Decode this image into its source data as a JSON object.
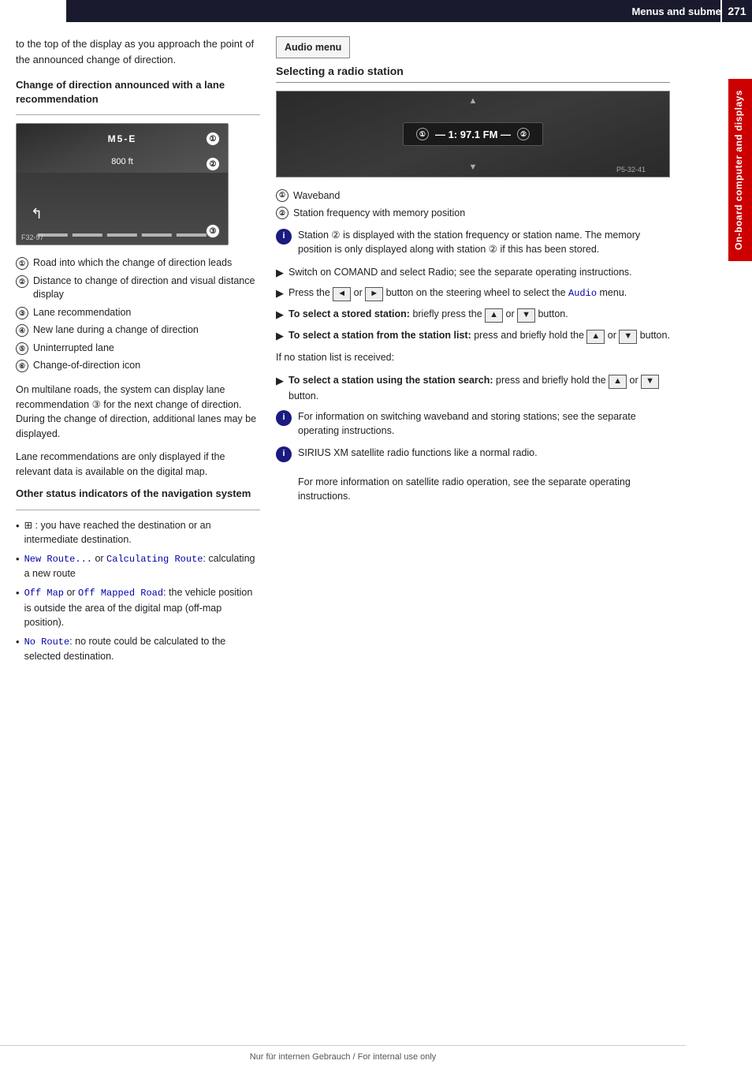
{
  "header": {
    "title": "Menus and submenus",
    "page_number": "271"
  },
  "side_tab": {
    "label": "On-board computer and displays"
  },
  "left_col": {
    "intro": "to the top of the display as you approach the point of the announced change of direction.",
    "section1": {
      "heading": "Change of direction announced with a lane recommendation",
      "nav_image": {
        "label_m5e": "M5-E",
        "badge_1": "①",
        "badge_2": "②",
        "badge_3": "③",
        "dist_label": "800 ft",
        "bottom_label": "F32-97"
      },
      "numbered_items": [
        {
          "num": "①",
          "text": "Road into which the change of direction leads"
        },
        {
          "num": "②",
          "text": "Distance to change of direction and visual distance display"
        },
        {
          "num": "③",
          "text": "Lane recommendation"
        },
        {
          "num": "④",
          "text": "New lane during a change of direction"
        },
        {
          "num": "⑤",
          "text": "Uninterrupted lane"
        },
        {
          "num": "⑥",
          "text": "Change-of-direction icon"
        }
      ],
      "body_text": [
        "On multilane roads, the system can display lane recommendation ③ for the next change of direction. During the change of direction, additional lanes may be displayed.",
        "Lane recommendations are only displayed if the relevant data is available on the digital map."
      ]
    },
    "section2": {
      "heading": "Other status indicators of the navigation system",
      "bullets": [
        {
          "icon": "⊞",
          "text": " : you have reached the destination or an intermediate destination."
        },
        {
          "text_prefix": "New Route...",
          "text_mid": " or ",
          "text_code": "Calculating Route",
          "text_suffix": ": calculating a new route"
        },
        {
          "text_prefix": "Off Map",
          "text_mid": " or ",
          "text_code": "Off Mapped Road",
          "text_suffix": ": the vehicle position is outside the area of the digital map (off-map position)."
        },
        {
          "text_prefix": "No Route",
          "text_suffix": ": no route could be calculated to the selected destination."
        }
      ]
    }
  },
  "right_col": {
    "audio_menu_label": "Audio menu",
    "section_heading": "Selecting a radio station",
    "radio_image": {
      "display_text": "1: 97.1 FM",
      "badge_1": "①",
      "badge_2": "②",
      "bottom_label": "P5-32-41"
    },
    "waveband_items": [
      {
        "num": "①",
        "text": "Waveband"
      },
      {
        "num": "②",
        "text": "Station frequency with memory position"
      }
    ],
    "info_boxes": [
      {
        "icon": "i",
        "text": "Station ② is displayed with the station frequency or station name. The memory position is only displayed along with station ② if this has been stored."
      }
    ],
    "steps": [
      {
        "type": "arrow",
        "text": "Switch on COMAND and select Radio; see the separate operating instructions."
      },
      {
        "type": "arrow",
        "text_before": "Press the ",
        "btn_left": "◄",
        "text_mid": " or ",
        "btn_right": "►",
        "text_after": " button on the steering wheel to select the Audio menu.",
        "has_code": true,
        "code_word": "Audio"
      },
      {
        "type": "arrow_bold",
        "bold": "To select a stored station:",
        "text": " briefly press the ",
        "btn1": "▲",
        "text2": " or ",
        "btn2": "▼",
        "text3": " button."
      },
      {
        "type": "arrow_bold",
        "bold": "To select a station from the station list:",
        "text": " press and briefly hold the ",
        "btn1": "▲",
        "text2": " or ",
        "btn2": "▼",
        "text3": " button."
      }
    ],
    "if_no_station": "If no station list is received:",
    "steps2": [
      {
        "type": "arrow_bold",
        "bold": "To select a station using the station search:",
        "text": " press and briefly hold the ",
        "btn1": "▲",
        "text2": " or ",
        "btn2": "▼",
        "text3": " button."
      }
    ],
    "info_boxes2": [
      {
        "icon": "i",
        "text": "For information on switching waveband and storing stations; see the separate operating instructions."
      },
      {
        "icon": "i",
        "text_lines": [
          "SIRIUS XM satellite radio functions like a normal radio.",
          "For more information on satellite radio operation, see the separate operating instructions."
        ]
      }
    ]
  },
  "footer": {
    "text": "Nur für internen Gebrauch / For internal use only"
  }
}
